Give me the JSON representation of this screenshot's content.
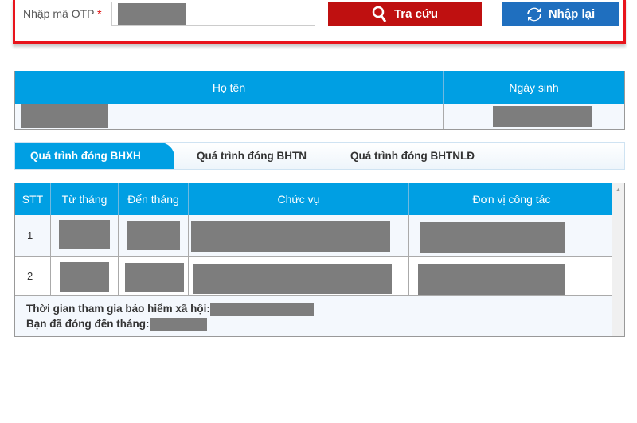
{
  "form": {
    "otp_label": "Nhập mã OTP",
    "required_mark": "*",
    "search_label": "Tra cứu",
    "reset_label": "Nhập lại"
  },
  "info": {
    "headers": [
      "Họ tên",
      "Ngày sinh"
    ]
  },
  "tabs": [
    "Quá trình đóng BHXH",
    "Quá trình đóng BHTN",
    "Quá trình đóng BHTNLĐ"
  ],
  "table": {
    "headers": [
      "STT",
      "Từ tháng",
      "Đến tháng",
      "Chức vụ",
      "Đơn vị công tác"
    ],
    "rows": [
      {
        "stt": "1"
      },
      {
        "stt": "2"
      }
    ]
  },
  "footer": {
    "participation_label": "Thời gian tham gia bảo hiểm xã hội:",
    "paid_until_label": "Bạn đã đóng đến tháng:"
  },
  "colors": {
    "red": "#e8141c",
    "blue": "#009fe3",
    "search_btn": "#bf1010",
    "reset_btn": "#1f6fbf"
  }
}
